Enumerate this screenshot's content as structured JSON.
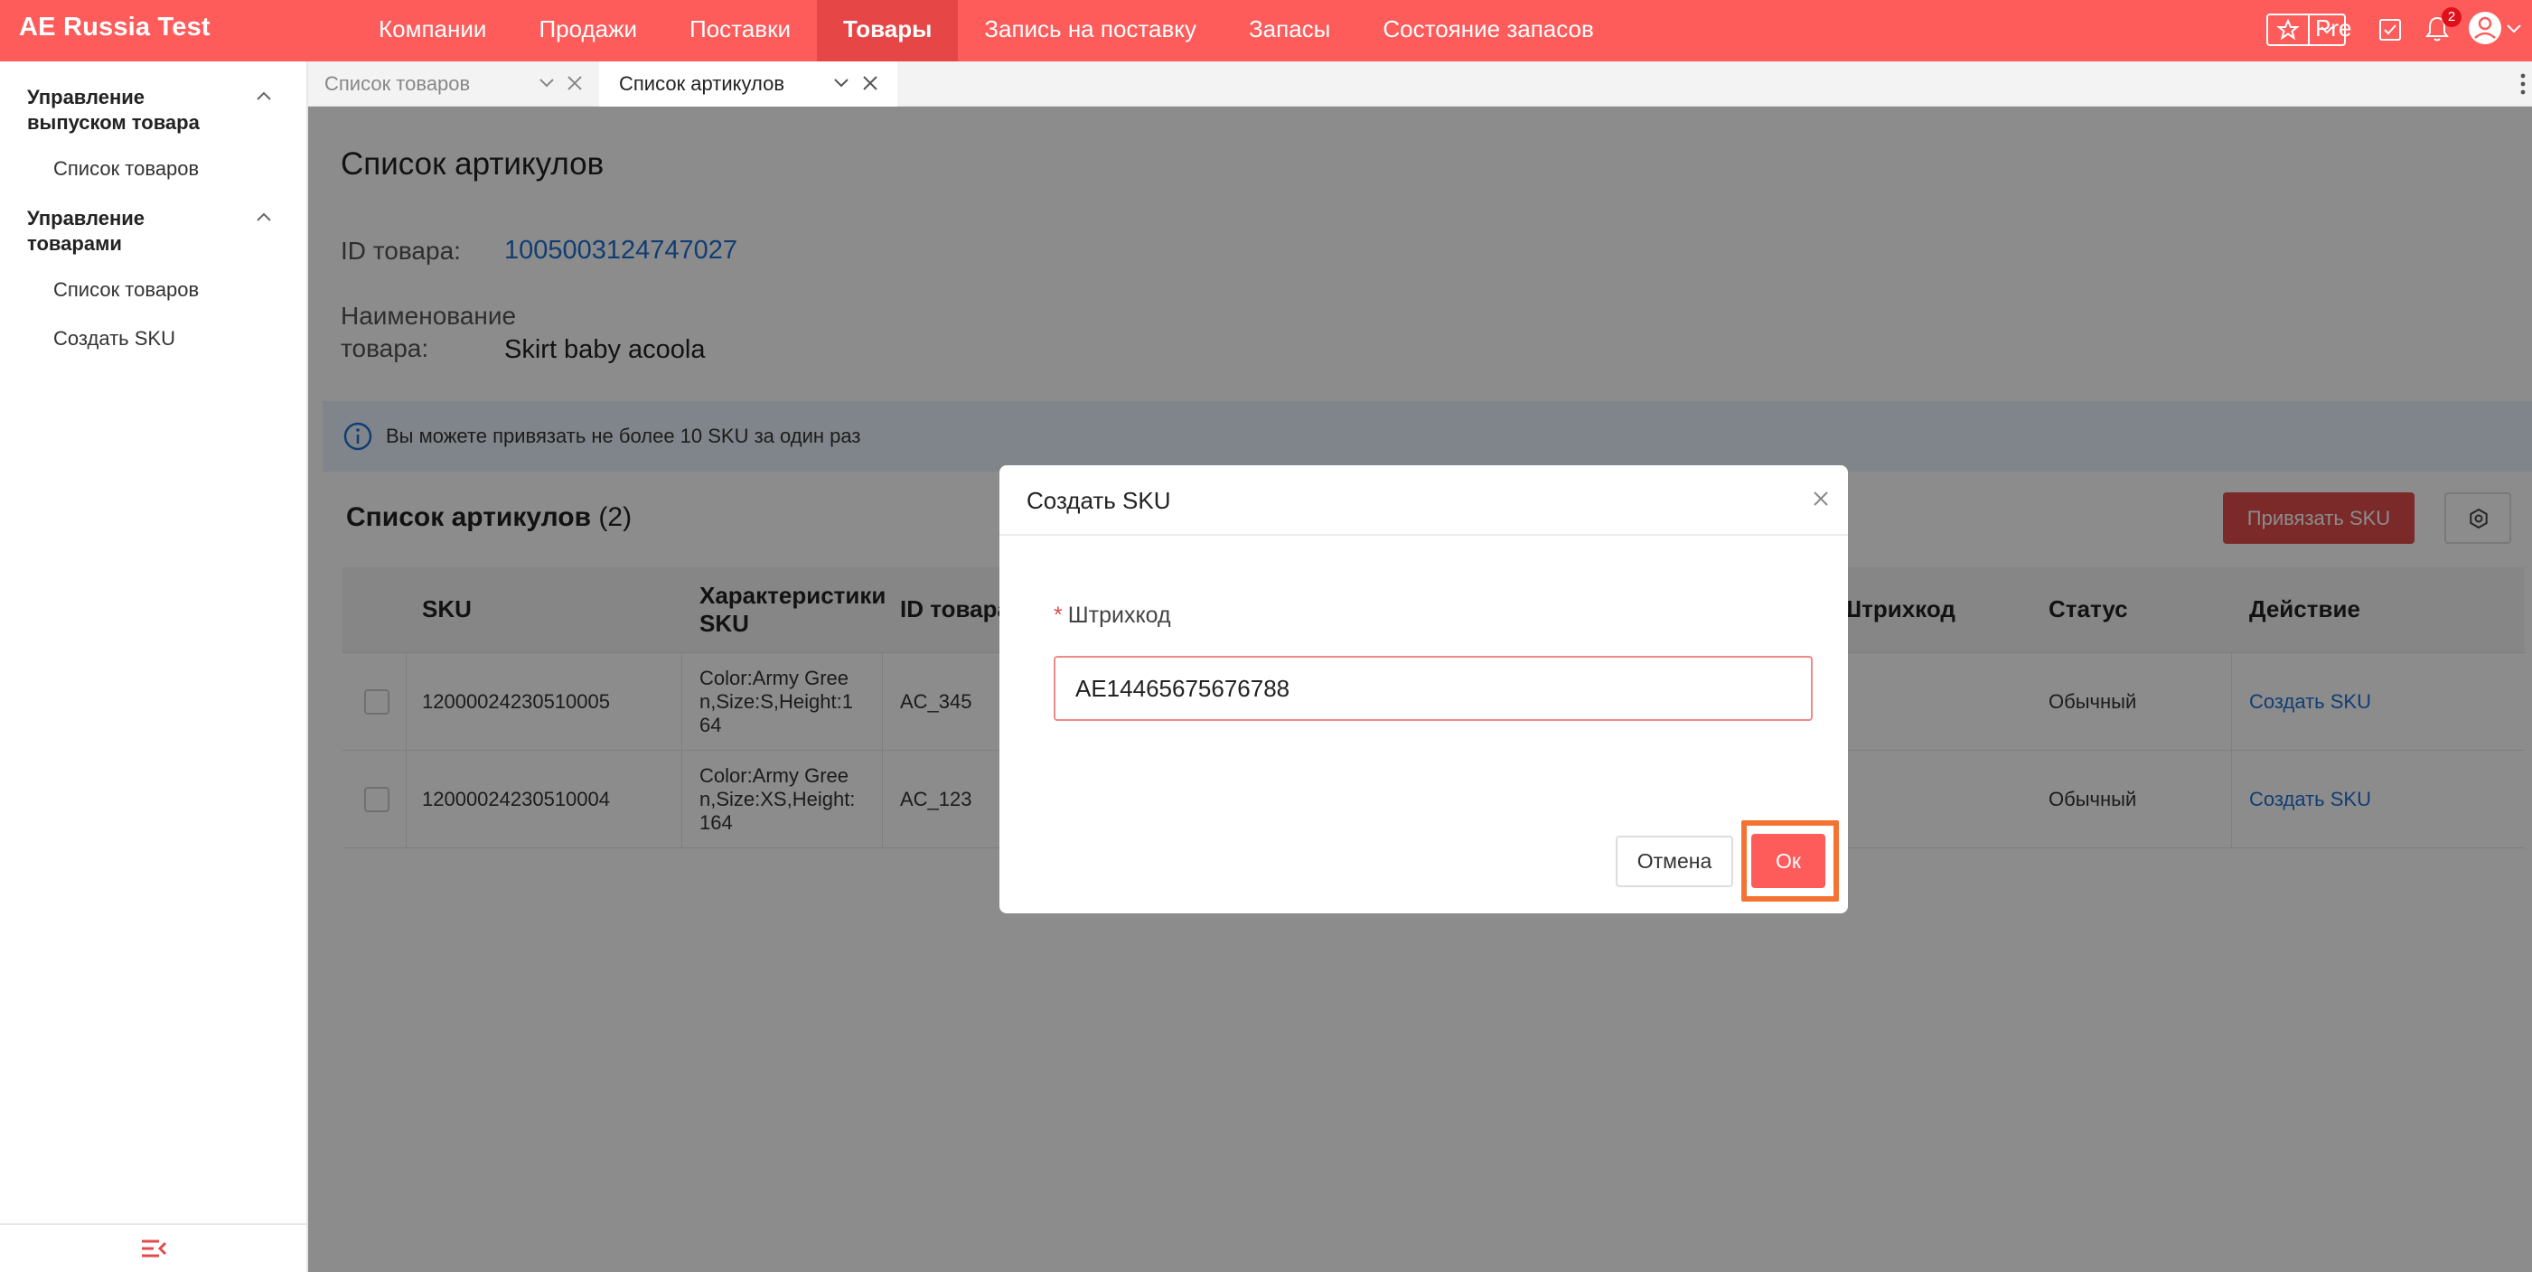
{
  "app": {
    "title": "AE Russia Test"
  },
  "topnav": {
    "items": [
      {
        "label": "Компании"
      },
      {
        "label": "Продажи"
      },
      {
        "label": "Поставки"
      },
      {
        "label": "Товары"
      },
      {
        "label": "Запись на поставку"
      },
      {
        "label": "Запасы"
      },
      {
        "label": "Состояние запасов"
      }
    ],
    "active_label": "Товары",
    "env_label": "Pre",
    "notification_count": "2"
  },
  "sidebar": {
    "groups": [
      {
        "title": "Управление выпуском товара",
        "items": [
          {
            "label": "Список товаров"
          }
        ]
      },
      {
        "title": "Управление товарами",
        "items": [
          {
            "label": "Список товаров"
          },
          {
            "label": "Создать SKU"
          }
        ]
      }
    ]
  },
  "tabs": [
    {
      "label": "Список товаров",
      "active": false
    },
    {
      "label": "Список артикулов",
      "active": true
    }
  ],
  "page": {
    "title": "Список артикулов",
    "product_id_label": "ID товара:",
    "product_id": "1005003124747027",
    "product_name_label": "Наименование товара:",
    "product_name": "Skirt baby acoola",
    "notice": "Вы можете привязать не более 10 SKU за один раз"
  },
  "sku_table": {
    "title": "Список артикулов",
    "count": "(2)",
    "bind_button": "Привязать SKU",
    "columns": [
      "SKU",
      "Характеристики SKU",
      "ID товара",
      "Штрихкод",
      "Статус",
      "Действие"
    ],
    "rows": [
      {
        "sku": "12000024230510005",
        "props": "Color:Army Green,Size:S,Height:164",
        "product_code": "AC_345",
        "barcode": "",
        "status": "Обычный",
        "action": "Создать SKU"
      },
      {
        "sku": "12000024230510004",
        "props": "Color:Army Green,Size:XS,Height:164",
        "product_code": "AC_123",
        "barcode": "",
        "status": "Обычный",
        "action": "Создать SKU"
      }
    ]
  },
  "modal": {
    "title": "Создать SKU",
    "barcode_label": "Штрихкод",
    "barcode_value": "AE14465675676788",
    "cancel_label": "Отмена",
    "ok_label": "Ок"
  },
  "colors": {
    "brand": "#fe5b5b",
    "brand_active": "#e64646",
    "link": "#1f6fd1",
    "highlight": "#f57332"
  }
}
